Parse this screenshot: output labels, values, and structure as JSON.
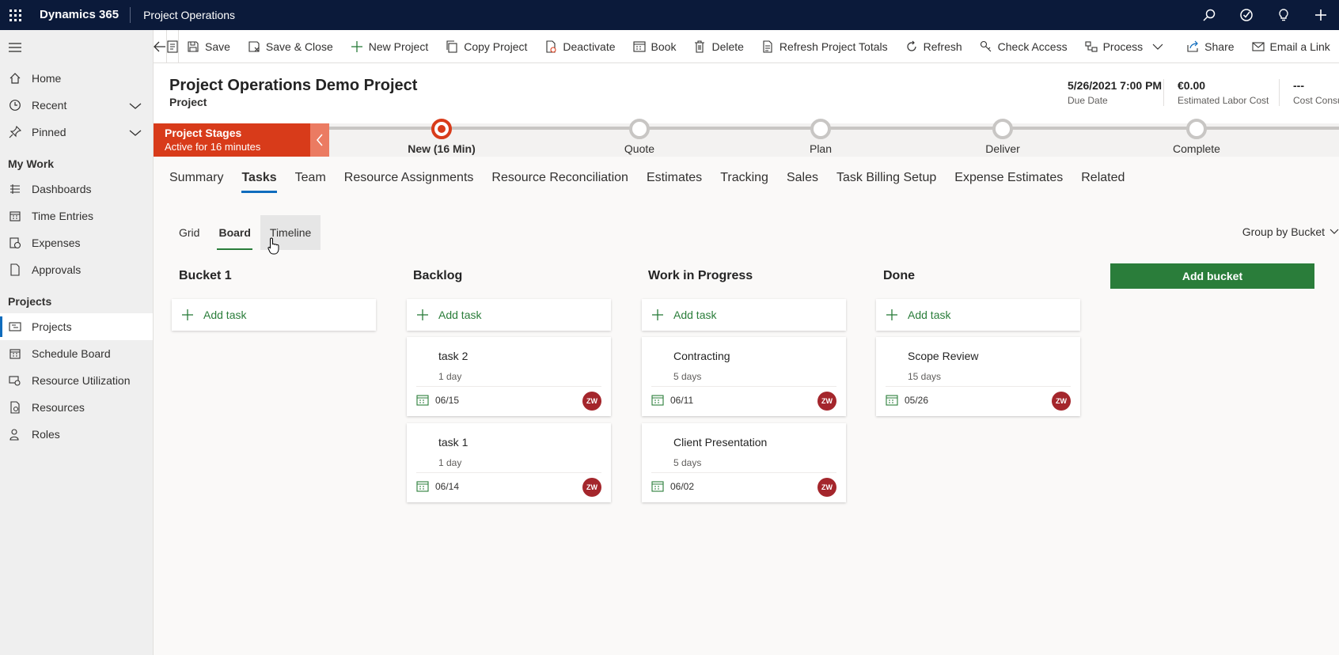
{
  "topbar": {
    "app_name": "Dynamics 365",
    "area_name": "Project Operations",
    "icons": [
      "waffle-icon",
      "search-icon",
      "task-check-icon",
      "lightbulb-icon",
      "plus-icon"
    ]
  },
  "sidenav": {
    "items_top": [
      {
        "label": "Home",
        "icon": "home-icon"
      },
      {
        "label": "Recent",
        "icon": "clock-icon"
      },
      {
        "label": "Pinned",
        "icon": "pin-icon"
      }
    ],
    "section_mywork": "My Work",
    "items_mywork": [
      {
        "label": "Dashboards",
        "icon": "dashboard-icon"
      },
      {
        "label": "Time Entries",
        "icon": "calendar-icon"
      },
      {
        "label": "Expenses",
        "icon": "expense-icon"
      },
      {
        "label": "Approvals",
        "icon": "document-icon"
      }
    ],
    "section_projects": "Projects",
    "items_projects": [
      {
        "label": "Projects",
        "icon": "projects-icon"
      },
      {
        "label": "Schedule Board",
        "icon": "calendar-icon"
      },
      {
        "label": "Resource Utilization",
        "icon": "utilization-icon"
      },
      {
        "label": "Resources",
        "icon": "resources-icon"
      },
      {
        "label": "Roles",
        "icon": "roles-icon"
      }
    ]
  },
  "cmdbar": {
    "save": "Save",
    "save_close": "Save & Close",
    "new_project": "New Project",
    "copy_project": "Copy Project",
    "deactivate": "Deactivate",
    "book": "Book",
    "delete": "Delete",
    "refresh_totals": "Refresh Project Totals",
    "refresh": "Refresh",
    "check_access": "Check Access",
    "process": "Process",
    "share": "Share",
    "email_link": "Email a Link"
  },
  "header": {
    "title": "Project Operations Demo Project",
    "entity": "Project",
    "fields": [
      {
        "value": "5/26/2021 7:00 PM",
        "label": "Due Date"
      },
      {
        "value": "€0.00",
        "label": "Estimated Labor Cost"
      },
      {
        "value": "---",
        "label": "Cost Consu"
      }
    ]
  },
  "bpf": {
    "title": "Project Stages",
    "subtitle": "Active for 16 minutes",
    "stages": [
      {
        "label": "New  (16 Min)",
        "active": true
      },
      {
        "label": "Quote",
        "active": false
      },
      {
        "label": "Plan",
        "active": false
      },
      {
        "label": "Deliver",
        "active": false
      },
      {
        "label": "Complete",
        "active": false
      }
    ]
  },
  "tabs": [
    "Summary",
    "Tasks",
    "Team",
    "Resource Assignments",
    "Resource Reconciliation",
    "Estimates",
    "Tracking",
    "Sales",
    "Task Billing Setup",
    "Expense Estimates",
    "Related"
  ],
  "active_tab": "Tasks",
  "subtabs": {
    "grid": "Grid",
    "board": "Board",
    "timeline": "Timeline",
    "group_by": "Group by Bucket"
  },
  "board": {
    "add_task": "Add task",
    "add_bucket": "Add bucket",
    "buckets": [
      {
        "name": "Bucket 1",
        "cards": []
      },
      {
        "name": "Backlog",
        "cards": [
          {
            "title": "task 2",
            "duration": "1 day",
            "date": "06/15",
            "assignee": "ZW"
          },
          {
            "title": "task 1",
            "duration": "1 day",
            "date": "06/14",
            "assignee": "ZW"
          }
        ]
      },
      {
        "name": "Work in Progress",
        "cards": [
          {
            "title": "Contracting",
            "duration": "5 days",
            "date": "06/11",
            "assignee": "ZW"
          },
          {
            "title": "Client Presentation",
            "duration": "5 days",
            "date": "06/02",
            "assignee": "ZW"
          }
        ]
      },
      {
        "name": "Done",
        "cards": [
          {
            "title": "Scope Review",
            "duration": "15 days",
            "date": "05/26",
            "assignee": "ZW"
          }
        ]
      }
    ]
  },
  "colors": {
    "topbar": "#0b1a3a",
    "bpf_active": "#d83b1a",
    "accent_green": "#2a7d3a",
    "avatar": "#a4262c",
    "tab_underline": "#0f6cbd"
  }
}
